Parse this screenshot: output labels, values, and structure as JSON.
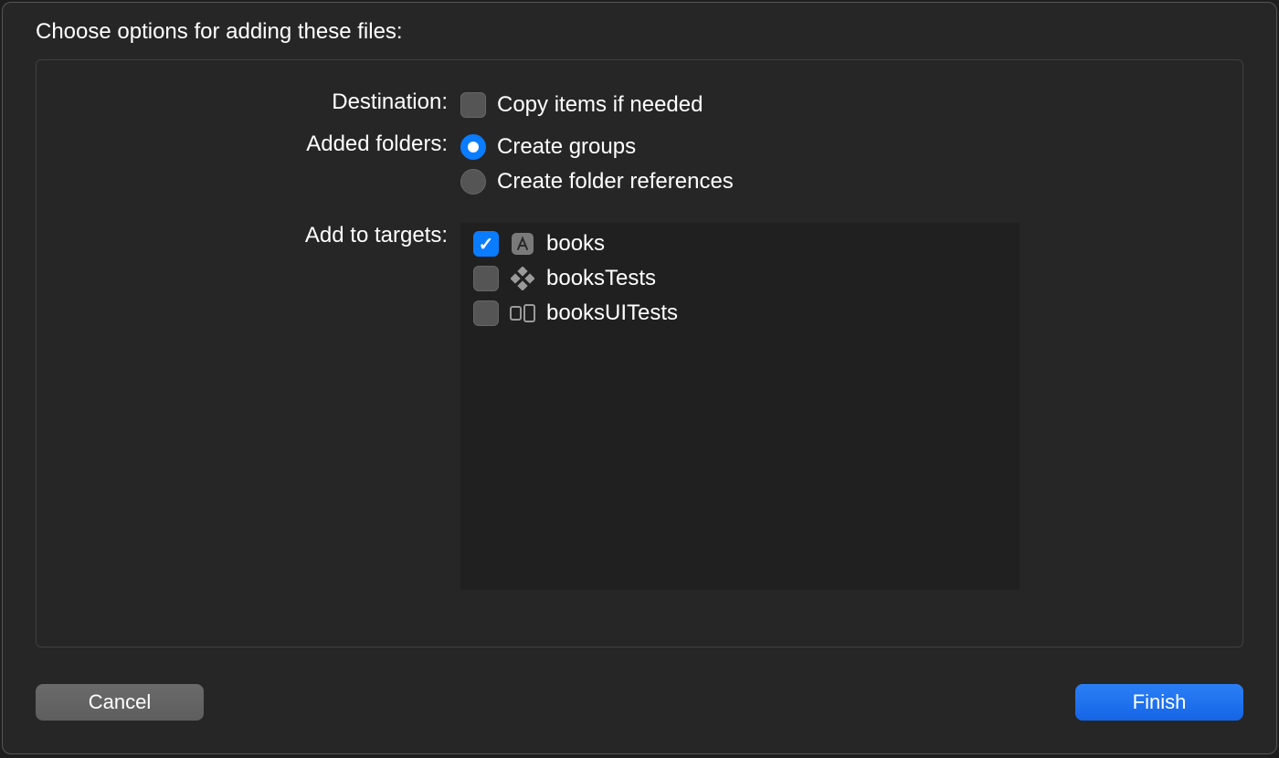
{
  "title": "Choose options for adding these files:",
  "labels": {
    "destination": "Destination:",
    "added_folders": "Added folders:",
    "add_to_targets": "Add to targets:"
  },
  "destination": {
    "copy_items_label": "Copy items if needed",
    "copy_items_checked": false
  },
  "added_folders": {
    "create_groups_label": "Create groups",
    "create_references_label": "Create folder references",
    "selected": "create_groups"
  },
  "targets": [
    {
      "name": "books",
      "checked": true,
      "icon": "app-icon"
    },
    {
      "name": "booksTests",
      "checked": false,
      "icon": "tests-icon"
    },
    {
      "name": "booksUITests",
      "checked": false,
      "icon": "ui-tests-icon"
    }
  ],
  "buttons": {
    "cancel": "Cancel",
    "finish": "Finish"
  }
}
